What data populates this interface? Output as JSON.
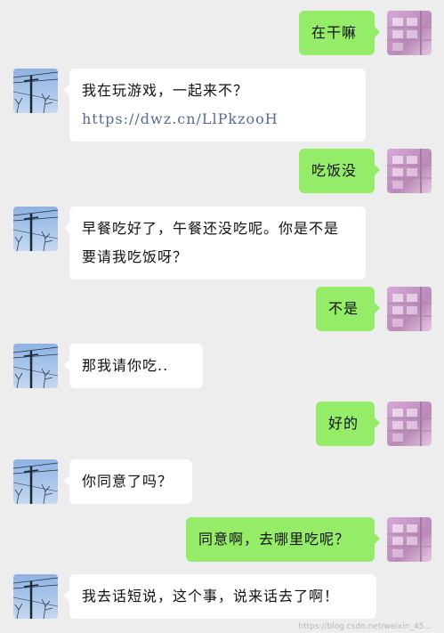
{
  "messages": [
    {
      "side": "right",
      "text": "在干嘛"
    },
    {
      "side": "left",
      "text": "我在玩游戏，一起来不？",
      "link": "https://dwz.cn/LlPkzooH"
    },
    {
      "side": "right",
      "text": "吃饭没"
    },
    {
      "side": "left",
      "text": "早餐吃好了，午餐还没吃呢。你是不是要请我吃饭呀？"
    },
    {
      "side": "right",
      "text": "不是"
    },
    {
      "side": "left",
      "text": "那我请你吃.."
    },
    {
      "side": "right",
      "text": "好的"
    },
    {
      "side": "left",
      "text": "你同意了吗？"
    },
    {
      "side": "right",
      "text": "同意啊，去哪里吃呢？"
    },
    {
      "side": "left",
      "text": "我去话短说，这个事，说来话去了啊！"
    }
  ],
  "watermark": "https://blog.csdn.net/weixin_45..."
}
